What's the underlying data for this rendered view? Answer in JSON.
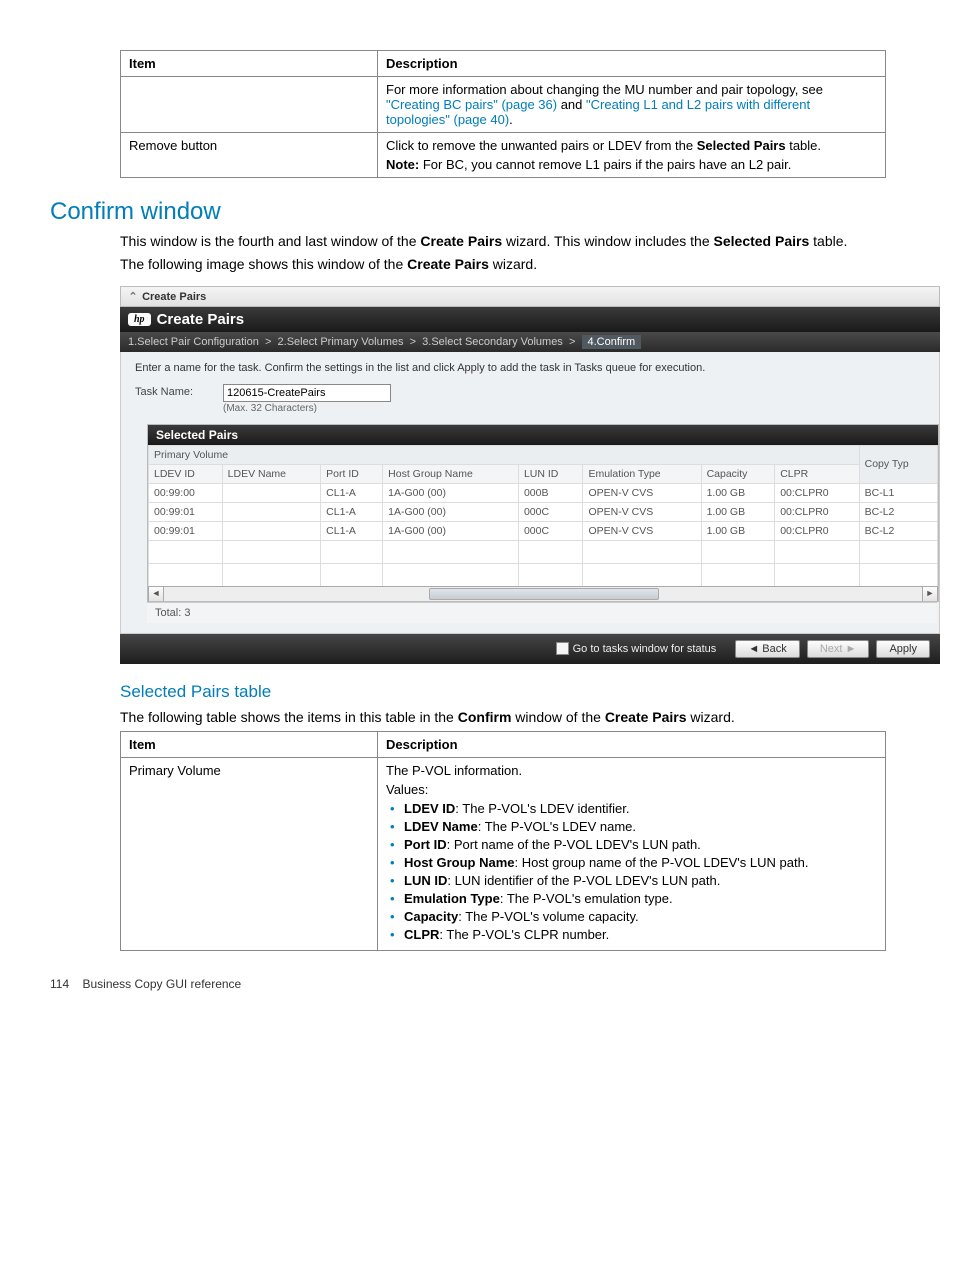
{
  "topTable": {
    "headers": {
      "item": "Item",
      "description": "Description"
    },
    "rows": [
      {
        "item": "",
        "desc_prefix": "For more information about changing the MU number and pair topology, see ",
        "link1": "\"Creating BC pairs\" (page 36)",
        "conj": " and ",
        "link2": "\"Creating L1 and L2 pairs with different topologies\" (page 40)",
        "suffix": "."
      },
      {
        "item": "Remove button",
        "desc_line1_a": "Click to remove the unwanted pairs or LDEV from the ",
        "desc_line1_b": "Selected Pairs",
        "desc_line1_c": " table.",
        "desc_line2_a": "Note:",
        "desc_line2_b": " For BC, you cannot remove L1 pairs if the pairs have an L2 pair."
      }
    ]
  },
  "section": {
    "title": "Confirm window",
    "para1_a": "This window is the fourth and last window of the ",
    "para1_b": "Create Pairs",
    "para1_c": " wizard. This window includes the ",
    "para1_d": "Selected Pairs",
    "para1_e": " table.",
    "para2_a": "The following image shows this window of the ",
    "para2_b": "Create Pairs",
    "para2_c": " wizard."
  },
  "screenshot": {
    "windowTitle": "Create Pairs",
    "dialogTitle": "Create Pairs",
    "steps": {
      "s1": "1.Select Pair Configuration",
      "s2": "2.Select Primary Volumes",
      "s3": "3.Select Secondary Volumes",
      "s4": "4.Confirm",
      "sep": ">"
    },
    "instruction": "Enter a name for the task. Confirm the settings in the list and click Apply to add the task in Tasks queue for execution.",
    "taskNameLabel": "Task Name:",
    "taskNameValue": "120615-CreatePairs",
    "taskNameHint": "(Max. 32 Characters)",
    "selectedPairsTitle": "Selected Pairs",
    "groupHeader": {
      "pv": "Primary Volume",
      "ct": "Copy Typ"
    },
    "columns": {
      "ldevId": "LDEV ID",
      "ldevName": "LDEV Name",
      "portId": "Port ID",
      "hostGroup": "Host Group Name",
      "lunId": "LUN ID",
      "emu": "Emulation Type",
      "capacity": "Capacity",
      "clpr": "CLPR"
    },
    "rows": [
      {
        "ldevId": "00:99:00",
        "ldevName": "",
        "portId": "CL1-A",
        "hostGroup": "1A-G00 (00)",
        "lunId": "000B",
        "emu": "OPEN-V CVS",
        "capacity": "1.00 GB",
        "clpr": "00:CLPR0",
        "ct": "BC-L1"
      },
      {
        "ldevId": "00:99:01",
        "ldevName": "",
        "portId": "CL1-A",
        "hostGroup": "1A-G00 (00)",
        "lunId": "000C",
        "emu": "OPEN-V CVS",
        "capacity": "1.00 GB",
        "clpr": "00:CLPR0",
        "ct": "BC-L2"
      },
      {
        "ldevId": "00:99:01",
        "ldevName": "",
        "portId": "CL1-A",
        "hostGroup": "1A-G00 (00)",
        "lunId": "000C",
        "emu": "OPEN-V CVS",
        "capacity": "1.00 GB",
        "clpr": "00:CLPR0",
        "ct": "BC-L2"
      }
    ],
    "totalLabel": "Total: 3",
    "footer": {
      "goto": "Go to tasks window for status",
      "back": "Back",
      "next": "Next",
      "apply": "Apply"
    }
  },
  "subsection": {
    "title": "Selected Pairs table",
    "para_a": "The following table shows the items in this table in the ",
    "para_b": "Confirm",
    "para_c": " window of the ",
    "para_d": "Create Pairs",
    "para_e": " wizard."
  },
  "bottomTable": {
    "headers": {
      "item": "Item",
      "description": "Description"
    },
    "row": {
      "item": "Primary Volume",
      "desc1": "The P-VOL information.",
      "desc2": "Values:",
      "bullets": [
        {
          "b": "LDEV ID",
          "t": ": The P-VOL's LDEV identifier."
        },
        {
          "b": "LDEV Name",
          "t": ": The P-VOL's LDEV name."
        },
        {
          "b": "Port ID",
          "t": ": Port name of the P-VOL LDEV's LUN path."
        },
        {
          "b": "Host Group Name",
          "t": ": Host group name of the P-VOL LDEV's LUN path."
        },
        {
          "b": "LUN ID",
          "t": ": LUN identifier of the P-VOL LDEV's LUN path."
        },
        {
          "b": "Emulation Type",
          "t": ": The P-VOL's emulation type."
        },
        {
          "b": "Capacity",
          "t": ": The P-VOL's volume capacity."
        },
        {
          "b": "CLPR",
          "t": ": The P-VOL's CLPR number."
        }
      ]
    }
  },
  "pageFooter": {
    "num": "114",
    "text": "Business Copy GUI reference"
  }
}
